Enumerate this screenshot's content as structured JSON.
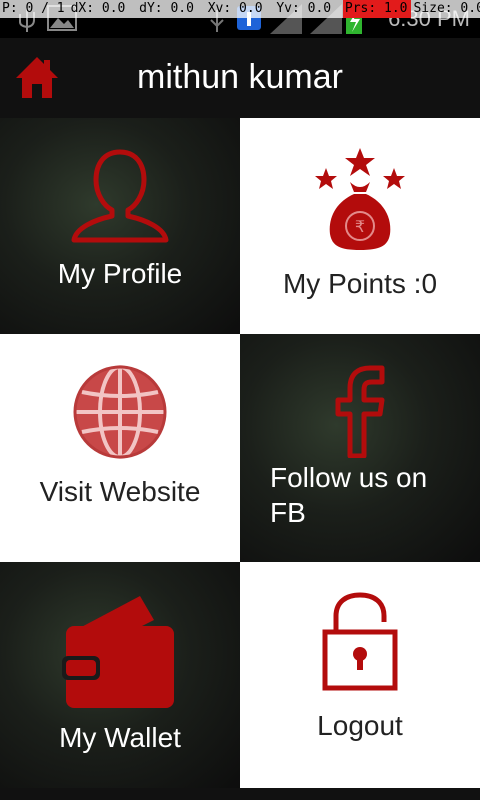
{
  "status": {
    "debug": [
      "P: 0 / 1",
      "dX: 0.0",
      "dY: 0.0",
      "Xv: 0.0",
      "Yv: 0.0",
      "Prs: 1.0",
      "Size: 0.0"
    ],
    "time": "6:30 PM"
  },
  "header": {
    "title": "mithun kumar"
  },
  "tiles": {
    "profile": "My Profile",
    "points": "My Points :0",
    "website": "Visit Website",
    "fb": "Follow us on FB",
    "wallet": "My Wallet",
    "logout": "Logout"
  },
  "colors": {
    "accent": "#b30c0c"
  }
}
